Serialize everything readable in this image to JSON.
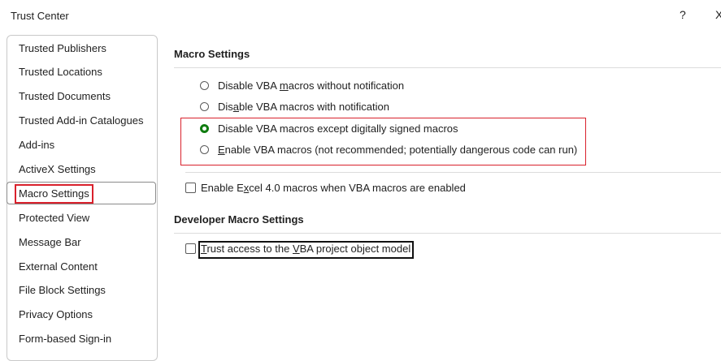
{
  "window": {
    "title": "Trust Center",
    "help_label": "?",
    "close_label": "X"
  },
  "sidebar": {
    "items": [
      {
        "label": "Trusted Publishers"
      },
      {
        "label": "Trusted Locations"
      },
      {
        "label": "Trusted Documents"
      },
      {
        "label": "Trusted Add-in Catalogues"
      },
      {
        "label": "Add-ins"
      },
      {
        "label": "ActiveX Settings"
      },
      {
        "label": "Macro Settings",
        "selected": true
      },
      {
        "label": "Protected View"
      },
      {
        "label": "Message Bar"
      },
      {
        "label": "External Content"
      },
      {
        "label": "File Block Settings"
      },
      {
        "label": "Privacy Options"
      },
      {
        "label": "Form-based Sign-in"
      }
    ]
  },
  "macro_settings": {
    "title": "Macro Settings",
    "options": [
      {
        "pre": "Disable VBA ",
        "key": "m",
        "post": "acros without notification",
        "checked": false
      },
      {
        "pre": "Dis",
        "key": "a",
        "post": "ble VBA macros with notification",
        "checked": false
      },
      {
        "pre": "Disable VBA macros except di",
        "key": "g",
        "post": "itally signed macros",
        "checked": true
      },
      {
        "pre": "",
        "key": "E",
        "post": "nable VBA macros (not recommended; potentially dangerous code can run)",
        "checked": false
      }
    ],
    "excel4": {
      "pre": "Enable E",
      "key": "x",
      "post": "cel 4.0 macros when VBA macros are enabled",
      "checked": false
    }
  },
  "developer": {
    "title": "Developer Macro Settings",
    "trust_vba": {
      "pre": "",
      "key": "T",
      "mid": "rust access to the ",
      "key2": "V",
      "post": "BA project object model",
      "checked": false
    }
  },
  "colors": {
    "highlight_red": "#d9212c",
    "radio_green": "#107c10"
  }
}
